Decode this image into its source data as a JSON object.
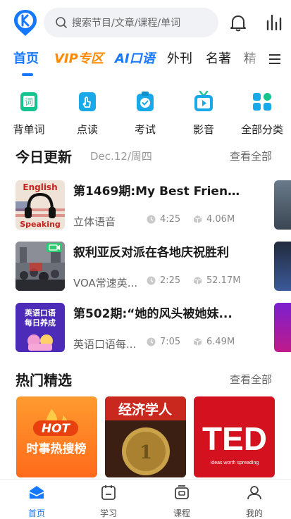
{
  "header": {
    "logo_icon": "app-logo-icon",
    "search_placeholder": "搜索节目/文章/课程/单词",
    "bell_icon": "bell-icon",
    "stats_icon": "bar-chart-icon"
  },
  "tabs": [
    {
      "label": "首页",
      "active": true
    },
    {
      "label": "VIP专区"
    },
    {
      "label": "AI口语"
    },
    {
      "label": "外刊"
    },
    {
      "label": "名著"
    },
    {
      "label": "精"
    }
  ],
  "categories": [
    {
      "label": "背单词",
      "icon": "vocabulary-icon"
    },
    {
      "label": "点读",
      "icon": "point-read-icon"
    },
    {
      "label": "考试",
      "icon": "exam-icon"
    },
    {
      "label": "影音",
      "icon": "video-icon"
    },
    {
      "label": "全部分类",
      "icon": "all-categories-icon"
    }
  ],
  "today": {
    "title": "今日更新",
    "date": "Dec.12/周四",
    "more": "查看全部",
    "items": [
      {
        "title": "第1469期:My Best Friend ...",
        "source": "立体语音",
        "duration": "4:25",
        "size": "4.06M",
        "thumb_text_top": "English",
        "thumb_text_bottom": "Speaking"
      },
      {
        "title": "叙利亚反对派在各地庆祝胜利",
        "source": "VOA常速英...",
        "duration": "2:25",
        "size": "52.17M"
      },
      {
        "title": "第502期:“她的风头被她妹...",
        "source": "英语口语每...",
        "duration": "7:05",
        "size": "6.49M",
        "thumb_text_top": "英语口语",
        "thumb_text_bottom": "每日养成"
      }
    ]
  },
  "hot": {
    "title": "热门精选",
    "more": "查看全部",
    "cards": [
      {
        "top": "HOT",
        "bottom": "时事热搜榜"
      },
      {
        "top": "经济学人"
      },
      {
        "top": "TED",
        "bottom": "ideas worth spreading"
      }
    ]
  },
  "nav": [
    {
      "label": "首页",
      "active": true,
      "icon": "home-icon"
    },
    {
      "label": "学习",
      "icon": "study-icon"
    },
    {
      "label": "课程",
      "icon": "course-icon"
    },
    {
      "label": "我的",
      "icon": "profile-icon"
    }
  ],
  "colors": {
    "accent": "#1677ff",
    "vip": "#ff8a00",
    "category_bg": "#1aa9e8"
  }
}
